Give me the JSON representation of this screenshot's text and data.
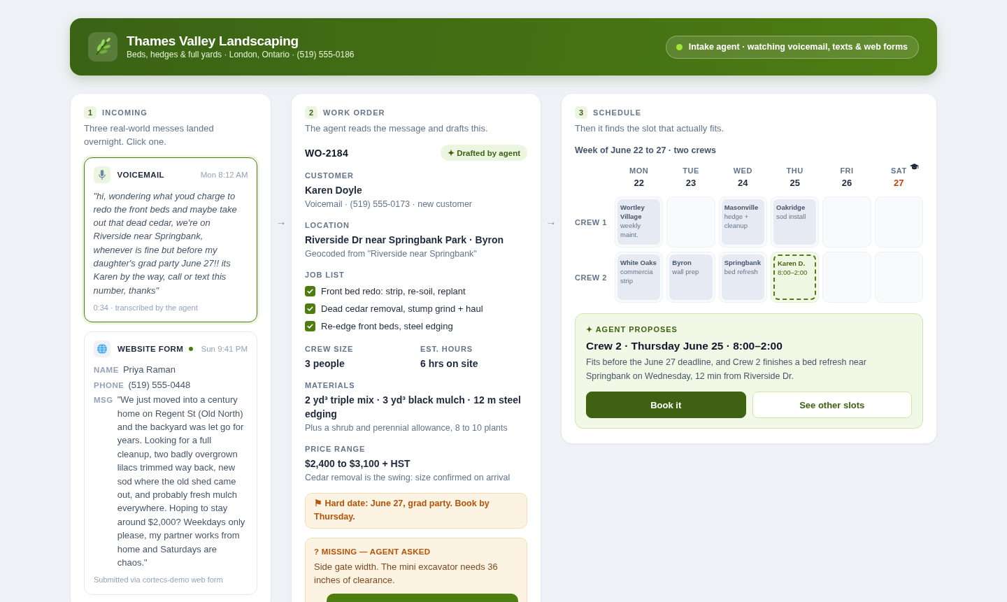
{
  "header": {
    "title": "Thames Valley Landscaping",
    "subtitle": "Beds, hedges & full yards · London, Ontario · (519) 555-0186",
    "status": {
      "label": "Intake agent · watching voicemail, texts & web forms",
      "on": true
    }
  },
  "flow_arrows": [
    "→",
    "→"
  ],
  "incoming": {
    "step": "1",
    "title": "INCOMING",
    "description": "Three real-world messes landed overnight. Click one.",
    "messages": [
      {
        "kind": "voicemail",
        "label": "VOICEMAIL",
        "time": "Mon 8:12 AM",
        "selected": true,
        "unread": false,
        "transcript": "\"hi, wondering what youd charge to redo the front beds and maybe take out that dead cedar, we're on Riverside near Springbank, whenever is fine but before my daughter's grad party June 27!! its Karen by the way, call or text this number, thanks\"",
        "footer": "0:34 · transcribed by the agent"
      },
      {
        "kind": "form",
        "label": "WEBSITE FORM",
        "time": "Sun 9:41 PM",
        "selected": false,
        "unread": true,
        "fields": [
          {
            "label": "NAME",
            "value": "Priya Raman"
          },
          {
            "label": "PHONE",
            "value": "(519) 555-0448"
          },
          {
            "label": "MSG",
            "value": "\"We just moved into a century home on Regent St (Old North) and the backyard was let go for years. Looking for a full cleanup, two badly overgrown lilacs trimmed way back, new sod where the old shed came out, and probably fresh mulch everywhere. Hoping to stay around $2,000? Weekdays only please, my partner works from home and Saturdays are chaos.\""
          }
        ],
        "footer": "Submitted via cortecs-demo web form"
      }
    ]
  },
  "work_order": {
    "step": "2",
    "title": "WORK ORDER",
    "description": "The agent reads the message and drafts this.",
    "id": "WO-2184",
    "badge": "✦ Drafted by agent",
    "sections": [
      {
        "kind": "field",
        "label": "CUSTOMER",
        "value": "Karen Doyle",
        "note": "Voicemail · (519) 555-0173 · new customer"
      },
      {
        "kind": "field",
        "label": "LOCATION",
        "value": "Riverside Dr near Springbank Park · Byron",
        "note": "Geocoded from \"Riverside near Springbank\""
      },
      {
        "kind": "checklist",
        "label": "JOB LIST",
        "items": [
          {
            "text": "Front bed redo: strip, re-soil, replant",
            "checked": true
          },
          {
            "text": "Dead cedar removal, stump grind + haul",
            "checked": true
          },
          {
            "text": "Re-edge front beds, steel edging",
            "checked": true
          }
        ]
      },
      {
        "kind": "pair",
        "columns": [
          {
            "label": "CREW SIZE",
            "value": "3 people"
          },
          {
            "label": "EST. HOURS",
            "value": "6 hrs on site"
          }
        ]
      },
      {
        "kind": "field",
        "label": "MATERIALS",
        "value": "2 yd³ triple mix · 3 yd³ black mulch · 12 m steel edging",
        "note": "Plus a shrub and perennial allowance, 8 to 10 plants"
      },
      {
        "kind": "field",
        "label": "PRICE RANGE",
        "value": "$2,400 to $3,100 + HST",
        "note": "Cedar removal is the swing: size confirmed on arrival"
      }
    ],
    "callouts": [
      {
        "kind": "deadline",
        "text": "⚑ Hard date: June 27, grad party. Book by Thursday."
      },
      {
        "kind": "question",
        "label": "? MISSING — AGENT ASKED",
        "text": "Side gate width. The mini excavator needs 36 inches of clearance."
      }
    ]
  },
  "schedule": {
    "step": "3",
    "title": "SCHEDULE",
    "description": "Then it finds the slot that actually fits.",
    "week": "Week of June 22 to 27 · two crews",
    "days": [
      {
        "name": "MON",
        "date": "22",
        "deadline": false
      },
      {
        "name": "TUE",
        "date": "23",
        "deadline": false
      },
      {
        "name": "WED",
        "date": "24",
        "deadline": false
      },
      {
        "name": "THU",
        "date": "25",
        "deadline": false
      },
      {
        "name": "FRI",
        "date": "26",
        "deadline": false
      },
      {
        "name": "SAT",
        "date": "27",
        "deadline": true
      }
    ],
    "crews": [
      {
        "name": "CREW 1",
        "slots": [
          {
            "kind": "job",
            "title": "Wortley Village",
            "detail": "weekly maint."
          },
          {
            "kind": "open"
          },
          {
            "kind": "job",
            "title": "Masonville",
            "detail": "hedge + cleanup"
          },
          {
            "kind": "job",
            "title": "Oakridge",
            "detail": "sod install"
          },
          {
            "kind": "open"
          },
          {
            "kind": "open"
          }
        ]
      },
      {
        "name": "CREW 2",
        "slots": [
          {
            "kind": "job",
            "title": "White Oaks",
            "detail": "commercia strip"
          },
          {
            "kind": "job",
            "title": "Byron",
            "detail": "wall prep"
          },
          {
            "kind": "job",
            "title": "Springbank",
            "detail": "bed refresh"
          },
          {
            "kind": "proposed",
            "title": "Karen D.",
            "detail": "8:00–2:00"
          },
          {
            "kind": "open"
          },
          {
            "kind": "open"
          }
        ]
      }
    ],
    "proposal": {
      "label": "✦ AGENT PROPOSES",
      "title": "Crew 2 · Thursday June 25 · 8:00–2:00",
      "description": "Fits before the June 27 deadline, and Crew 2 finishes a bed refresh near Springbank on Wednesday, 12 min from Riverside Dr.",
      "buttons": [
        {
          "kind": "primary",
          "label": "Book it"
        },
        {
          "kind": "secondary",
          "label": "See other slots"
        }
      ]
    }
  }
}
